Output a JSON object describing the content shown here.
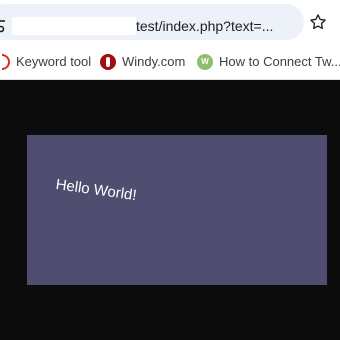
{
  "browser": {
    "address_bar": {
      "url_visible": "test/index.php?text=..."
    },
    "icons": {
      "site_info": "tune-icon",
      "bookmark": "star-icon"
    },
    "bookmarks": [
      {
        "label": "Keyword tool",
        "icon": "keyword-tool-favicon"
      },
      {
        "label": "Windy.com",
        "icon": "windy-favicon"
      },
      {
        "label": "How to Connect Tw...",
        "icon": "w-favicon"
      }
    ]
  },
  "page": {
    "canvas": {
      "text": "Hello World!",
      "background": "#4f4e70",
      "text_color": "#ffffff"
    },
    "background": "#0c0c0c"
  }
}
